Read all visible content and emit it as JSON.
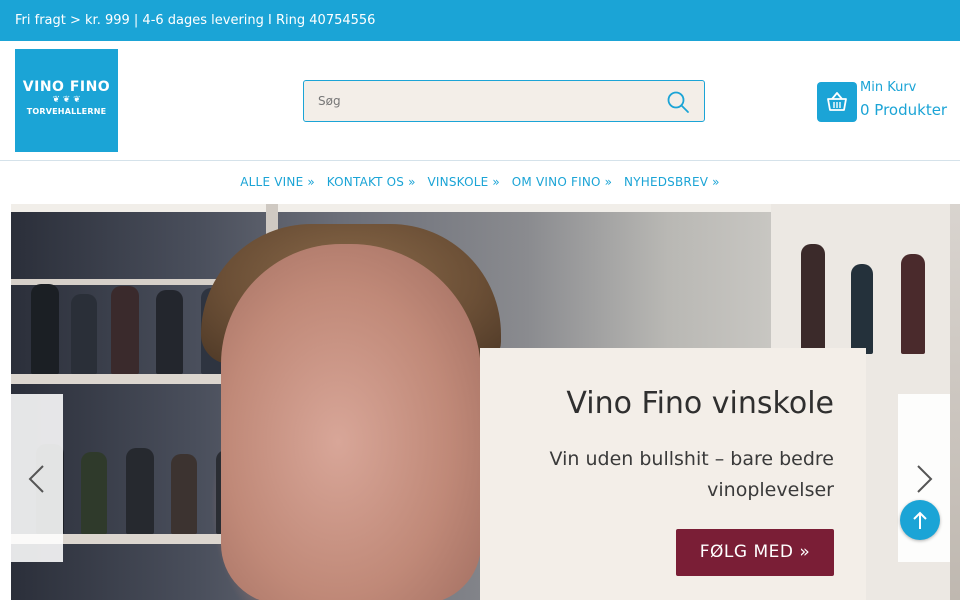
{
  "topbar": {
    "text": "Fri fragt > kr. 999 | 4-6 dages levering I Ring 40754556"
  },
  "logo": {
    "line1": "VINO FINO",
    "line2": "TORVEHALLERNE"
  },
  "search": {
    "placeholder": "Søg",
    "icon": "search-icon"
  },
  "cart": {
    "label": "Min Kurv",
    "count": "0 Produkter",
    "icon": "basket-icon"
  },
  "nav": {
    "items": [
      {
        "label": "ALLE VINE »"
      },
      {
        "label": "KONTAKT OS »"
      },
      {
        "label": "VINSKOLE »"
      },
      {
        "label": "OM VINO FINO »"
      },
      {
        "label": "NYHEDSBREV »"
      }
    ]
  },
  "hero": {
    "title": "Vino Fino vinskole",
    "text": "Vin uden bullshit – bare bedre vinoplevelser",
    "cta": "FØLG MED »"
  },
  "colors": {
    "brand": "#1ba4d6",
    "cta": "#7a1e36",
    "panel": "#f3eee8"
  }
}
